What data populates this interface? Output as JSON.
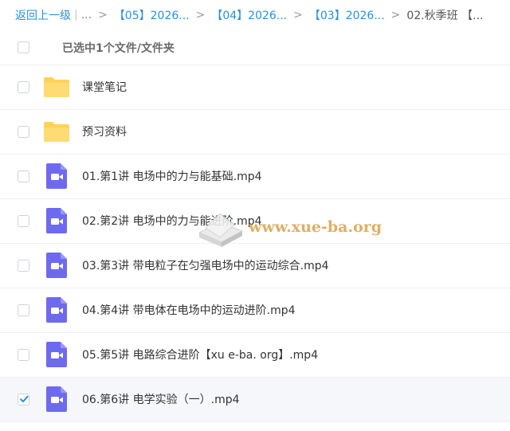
{
  "breadcrumb": {
    "back_label": "返回上一级",
    "ellipsis": "...",
    "items": [
      "【05】2026...",
      "【04】2026...",
      "【03】2026...",
      "02.秋季班 【..."
    ]
  },
  "header": {
    "selection_status": "已选中1个文件/文件夹"
  },
  "files": [
    {
      "name": "课堂笔记",
      "type": "folder",
      "checked": false
    },
    {
      "name": "预习资料",
      "type": "folder",
      "checked": false
    },
    {
      "name": "01.第1讲 电场中的力与能基础.mp4",
      "type": "video",
      "checked": false
    },
    {
      "name": "02.第2讲 电场中的力与能进阶.mp4",
      "type": "video",
      "checked": false
    },
    {
      "name": "03.第3讲 带电粒子在匀强电场中的运动综合.mp4",
      "type": "video",
      "checked": false
    },
    {
      "name": "04.第4讲 带电体在电场中的运动进阶.mp4",
      "type": "video",
      "checked": false
    },
    {
      "name": "05.第5讲 电路综合进阶【xu e-ba. org】.mp4",
      "type": "video",
      "checked": false
    },
    {
      "name": "06.第6讲 电学实验（一）.mp4",
      "type": "video",
      "checked": true
    }
  ],
  "watermark": {
    "text": "www.xue-ba.org"
  },
  "colors": {
    "link": "#2a8fde",
    "folder": "#ffd25c",
    "video": "#6e6af0",
    "checkbox_checked": "#2a8fde",
    "selected_row": "#f5f7fa"
  }
}
